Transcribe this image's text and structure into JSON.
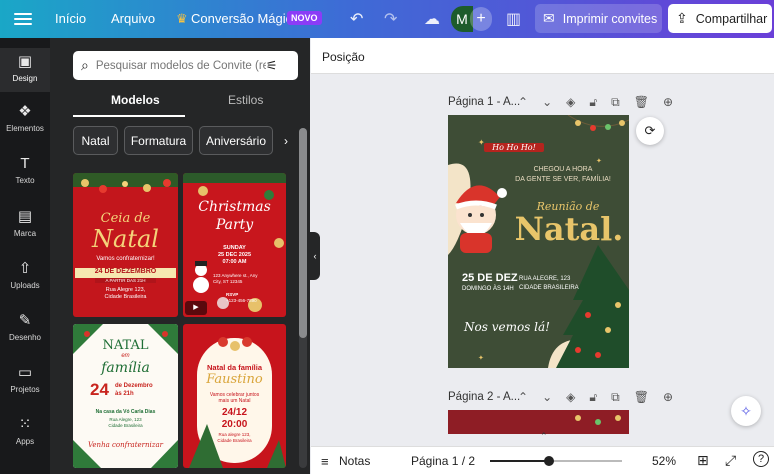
{
  "topbar": {
    "home": "Início",
    "file": "Arquivo",
    "magic": "Conversão Mágica",
    "magic_badge": "NOVO",
    "avatar": "M",
    "print_button": "Imprimir convites",
    "share_button": "Compartilhar"
  },
  "rail": {
    "items": [
      {
        "label": "Design",
        "icon": "layout-icon"
      },
      {
        "label": "Elementos",
        "icon": "elements-icon"
      },
      {
        "label": "Texto",
        "icon": "text-icon"
      },
      {
        "label": "Marca",
        "icon": "brand-icon"
      },
      {
        "label": "Uploads",
        "icon": "upload-icon"
      },
      {
        "label": "Desenho",
        "icon": "draw-icon"
      },
      {
        "label": "Projetos",
        "icon": "folder-icon"
      },
      {
        "label": "Apps",
        "icon": "apps-icon"
      }
    ]
  },
  "panel": {
    "search_placeholder": "Pesquisar modelos de Convite (ret",
    "tabs": [
      "Modelos",
      "Estilos"
    ],
    "chips": [
      "Natal",
      "Formatura",
      "Aniversário"
    ],
    "templates": [
      {
        "title1": "Ceia de",
        "title2": "Natal",
        "sub": "Vamos confraternizar!",
        "date": "24 DE DEZEMBRO",
        "time": "A PARTIR DAS 21H",
        "addr1": "Rua Alegre 123,",
        "addr2": "Cidade Brasileira"
      },
      {
        "title1": "Christmas",
        "title2": "Party",
        "sub": "SUNDAY",
        "date": "25 DEC 2025",
        "time": "07:00 AM",
        "addr1": "123 Anywhere st., Any",
        "addr2": "City, ST 12345",
        "rsvp": "RSVP",
        "phone": "+123-456-7890"
      },
      {
        "title1": "NATAL",
        "title2": "em",
        "title3": "família",
        "date": "24",
        "date2": "de Dezembro",
        "time": "às 21h",
        "place": "Na casa da Vó Carla Dias",
        "addr1": "Rua Alegre, 123",
        "addr2": "Cidade Brasileira",
        "footer": "Venha confraternizar"
      },
      {
        "title1": "Natal da família",
        "title2": "Faustino",
        "sub": "Vamos celebrar juntos mais um Natal",
        "date": "24/12",
        "time": "20:00",
        "addr1": "Rua alegre 123,",
        "addr2": "Cidade Brasileira"
      }
    ]
  },
  "canvas": {
    "position_label": "Posição",
    "page1_title": "Página 1 - A...",
    "page2_title": "Página 2 - A...",
    "invite": {
      "hohoho": "Ho Ho Ho!",
      "line1": "CHEGOU A HORA",
      "line2": "DA GENTE SE VER, FAMÍLIA!",
      "script": "Reunião de",
      "big": "Natal.",
      "date": "25 DE DEZ",
      "time": "DOMINGO ÀS 14H",
      "addr1": "RUA ALEGRE, 123",
      "addr2": "CIDADE BRASILEIRA",
      "footer": "Nos vemos lá!"
    }
  },
  "bottombar": {
    "notes": "Notas",
    "page_indicator": "Página 1 / 2",
    "zoom": "52%",
    "zoom_fraction": 0.52
  },
  "colors": {
    "accent": "#8b3cf7",
    "invite_bg": "#3e4d36",
    "gold": "#e8c56a"
  }
}
